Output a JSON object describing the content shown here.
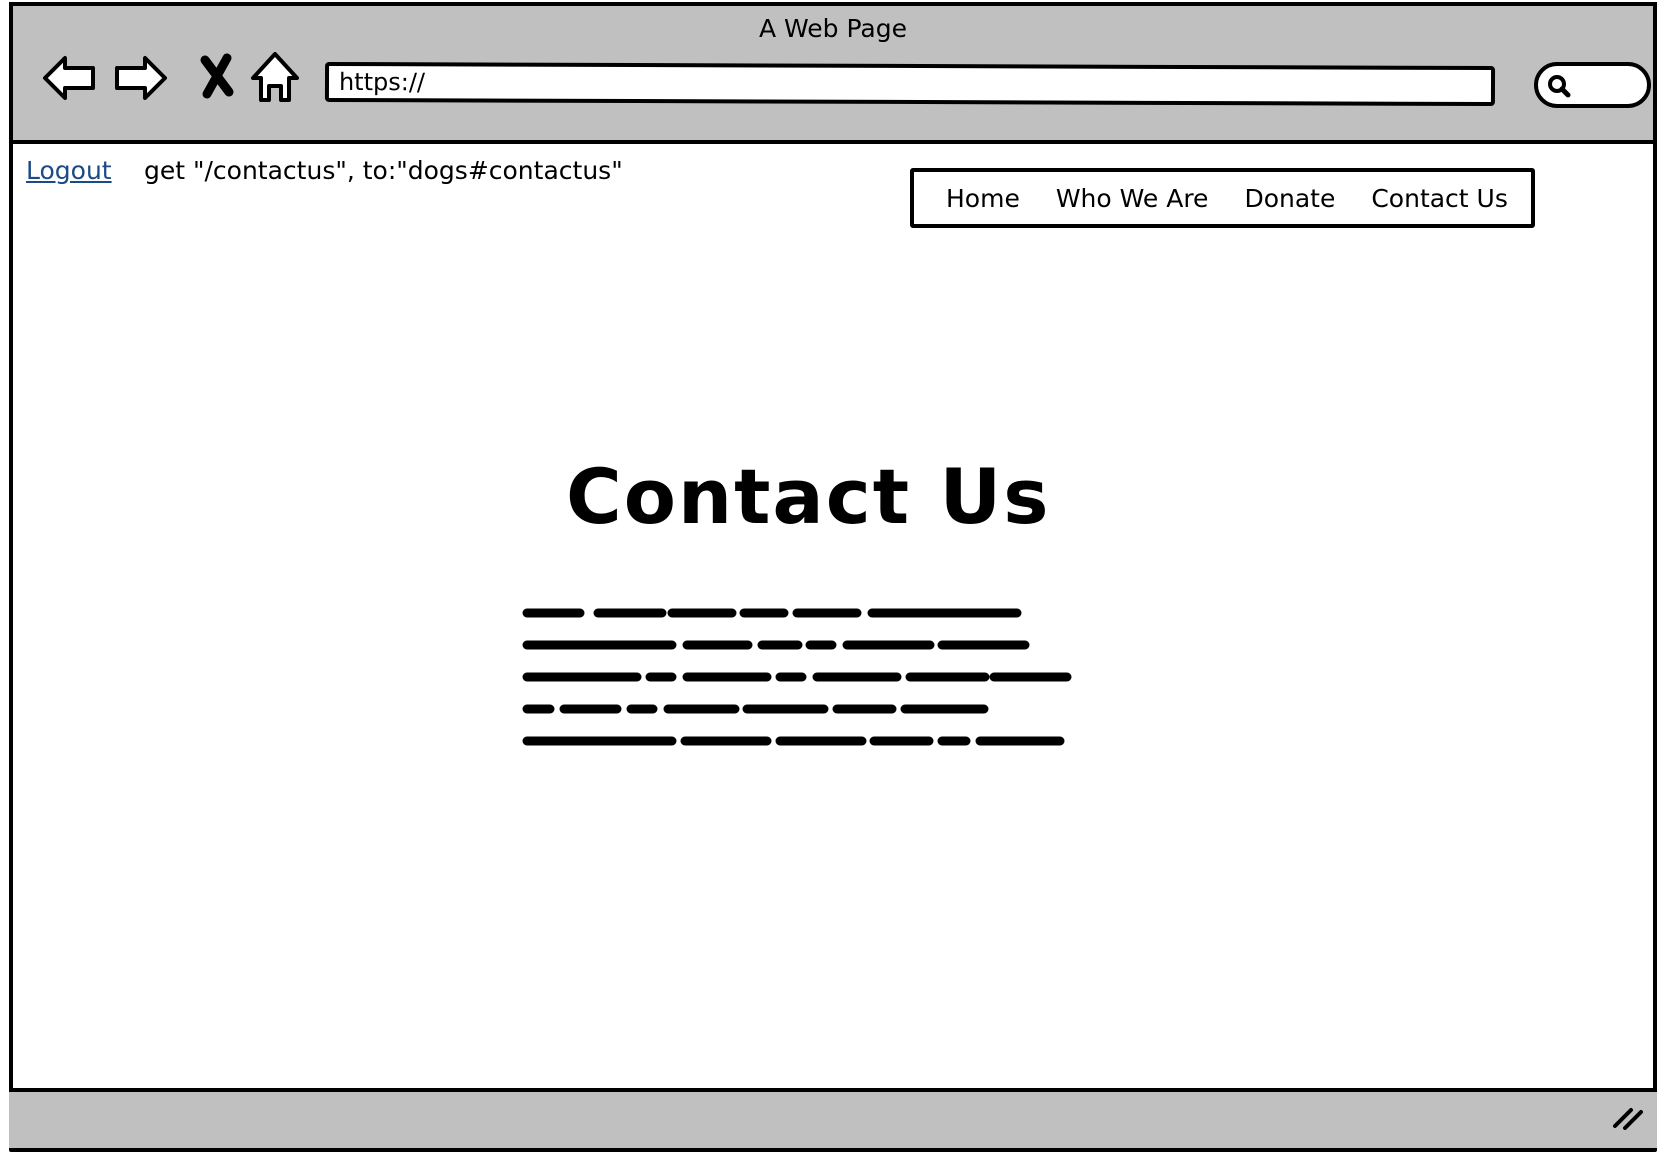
{
  "window": {
    "title": "A Web Page"
  },
  "toolbar": {
    "back_icon": "back-arrow-icon",
    "forward_icon": "forward-arrow-icon",
    "stop_icon": "close-x-icon",
    "home_icon": "home-icon",
    "url_value": "https://",
    "search_icon": "search-icon"
  },
  "header": {
    "logout_label": "Logout",
    "route_text": "get \"/contactus\", to:\"dogs#contactus\""
  },
  "nav": {
    "items": [
      {
        "label": "Home"
      },
      {
        "label": "Who We Are"
      },
      {
        "label": "Donate"
      },
      {
        "label": "Contact Us"
      }
    ]
  },
  "main": {
    "heading": "Contact Us"
  }
}
